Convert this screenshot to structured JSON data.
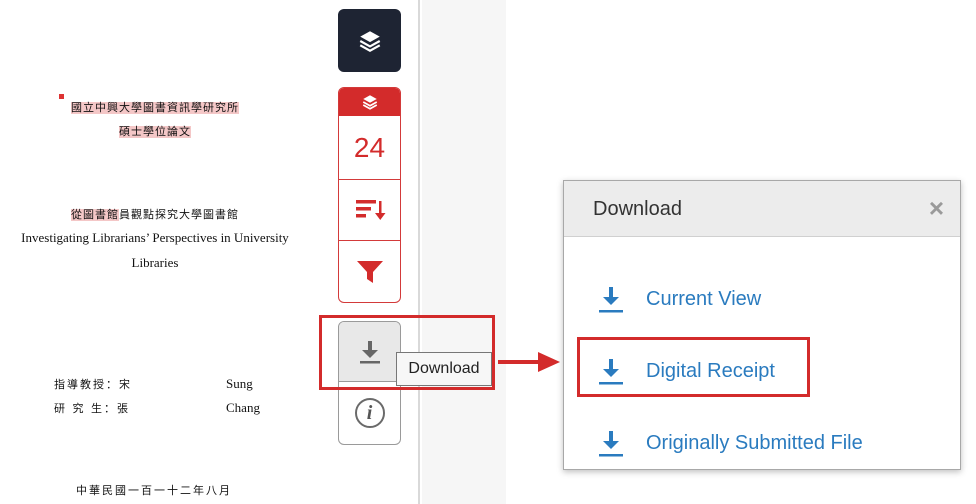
{
  "document": {
    "institution_line": "國立中興大學圖書資訊學研究所",
    "degree_line": "碩士學位論文",
    "title_zh_hl": "從圖書館",
    "title_zh_rest": "員觀點探究大學圖書館",
    "title_en_1": "Investigating Librarians’ Perspectives in University",
    "title_en_2": "Libraries",
    "advisor_label": "指導教授：宋",
    "advisor_name": "Sung",
    "student_label": "研 究 生：張",
    "student_name": "Chang",
    "date_line": "中華民國一百一十二年八月"
  },
  "toolbar": {
    "count": "24",
    "tooltip": "Download"
  },
  "dialog": {
    "title": "Download",
    "close": "×",
    "options": [
      "Current View",
      "Digital Receipt",
      "Originally Submitted File"
    ]
  },
  "colors": {
    "accent_red": "#d32b2b",
    "link_blue": "#2a7bbf",
    "dark_button": "#1e2433"
  },
  "icons": [
    "layers-icon",
    "layers-icon",
    "sort-icon",
    "filter-icon",
    "download-icon",
    "info-icon",
    "close-icon",
    "download-icon"
  ]
}
